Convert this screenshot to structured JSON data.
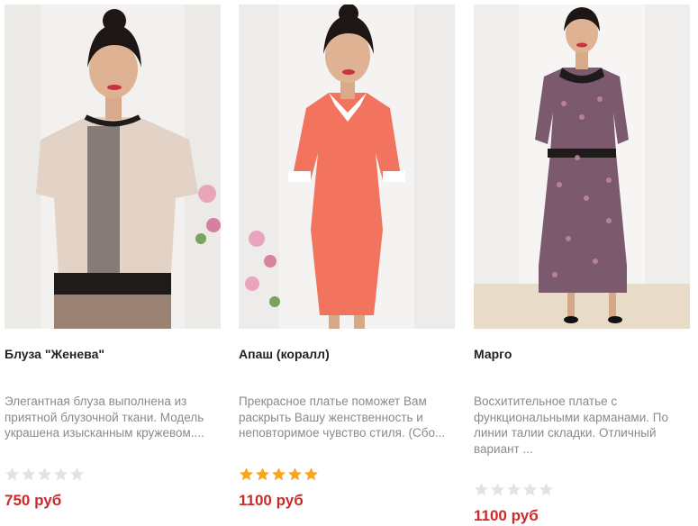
{
  "products": [
    {
      "title": "Блуза \"Женева\"",
      "description": "Элегантная блуза выполнена из приятной блузочной ткани. Модель украшена изысканным кружевом....",
      "rating": 0,
      "price": "750 руб"
    },
    {
      "title": "Апаш (коралл)",
      "description": "Прекрасное платье поможет Вам раскрыть Вашу женственность и неповторимое чувство стиля. (Сбо...",
      "rating": 5,
      "price": "1100 руб"
    },
    {
      "title": "Марго",
      "description": "Восхитительное платье с функциональными карманами. По линии талии складки. Отличный вариант ...",
      "rating": 0,
      "price": "1100 руб"
    }
  ],
  "colors": {
    "price": "#cc2a2a",
    "star_filled": "#f5a623",
    "star_empty": "#e3e3e3",
    "title": "#222222",
    "description": "#8a8a8a"
  }
}
